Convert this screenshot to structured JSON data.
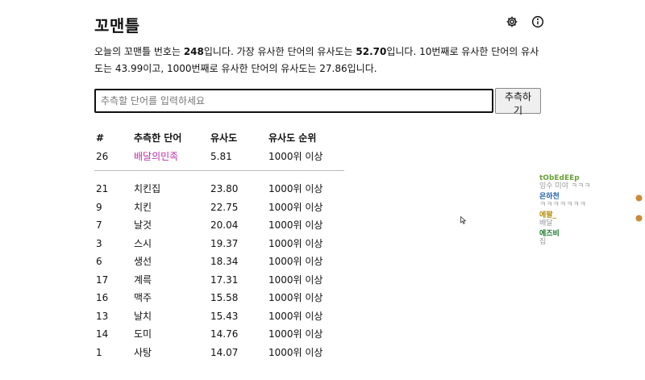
{
  "app": {
    "title": "꼬맨틀"
  },
  "header": {
    "settings_icon": "gear-icon",
    "info_icon": "info-icon"
  },
  "description": {
    "part1": "오늘의 꼬맨틀 번호는 ",
    "puzzle_number": "248",
    "part2": "입니다. 가장 유사한 단어의 유사도는 ",
    "top_similarity": "52.70",
    "part3": "입니다. 10번째로 유사한 단어의 유사도는 43.99이고, 1000번째로 유사한 단어의 유사도는 27.86입니다."
  },
  "guess": {
    "placeholder": "추측할 단어를 입력하세요",
    "value": "",
    "button_label": "추측하기"
  },
  "table": {
    "headers": [
      "#",
      "추측한 단어",
      "유사도",
      "유사도 순위"
    ],
    "latest": {
      "num": "26",
      "word": "배달의민족",
      "similarity": "5.81",
      "rank": "1000위 이상"
    },
    "rows": [
      {
        "num": "21",
        "word": "치킨집",
        "similarity": "23.80",
        "rank": "1000위 이상"
      },
      {
        "num": "9",
        "word": "치킨",
        "similarity": "22.75",
        "rank": "1000위 이상"
      },
      {
        "num": "7",
        "word": "날것",
        "similarity": "20.04",
        "rank": "1000위 이상"
      },
      {
        "num": "3",
        "word": "스시",
        "similarity": "19.37",
        "rank": "1000위 이상"
      },
      {
        "num": "6",
        "word": "생선",
        "similarity": "18.34",
        "rank": "1000위 이상"
      },
      {
        "num": "17",
        "word": "계륵",
        "similarity": "17.31",
        "rank": "1000위 이상"
      },
      {
        "num": "16",
        "word": "맥주",
        "similarity": "15.58",
        "rank": "1000위 이상"
      },
      {
        "num": "13",
        "word": "날치",
        "similarity": "15.43",
        "rank": "1000위 이상"
      },
      {
        "num": "14",
        "word": "도미",
        "similarity": "14.76",
        "rank": "1000위 이상"
      },
      {
        "num": "1",
        "word": "사탕",
        "similarity": "14.07",
        "rank": "1000위 이상"
      },
      {
        "num": "",
        "word": "",
        "similarity": "",
        "rank": ""
      }
    ]
  },
  "chat": [
    {
      "name": "tObEdEEp",
      "msg": "잉수 미야 ㅋㅋㅋ",
      "color": "#6a9f3a"
    },
    {
      "name": "은하천",
      "msg": "ㅋㅋㅋㅋㅋㅋㅋ",
      "color": "#1f5fb0"
    },
    {
      "name": "에팔_",
      "msg": "배달",
      "color": "#b08a00"
    },
    {
      "name": "에즈비",
      "msg": "집",
      "color": "#167a2a"
    }
  ],
  "colors": {
    "highlight": "#c02ea8",
    "text": "#111111"
  }
}
